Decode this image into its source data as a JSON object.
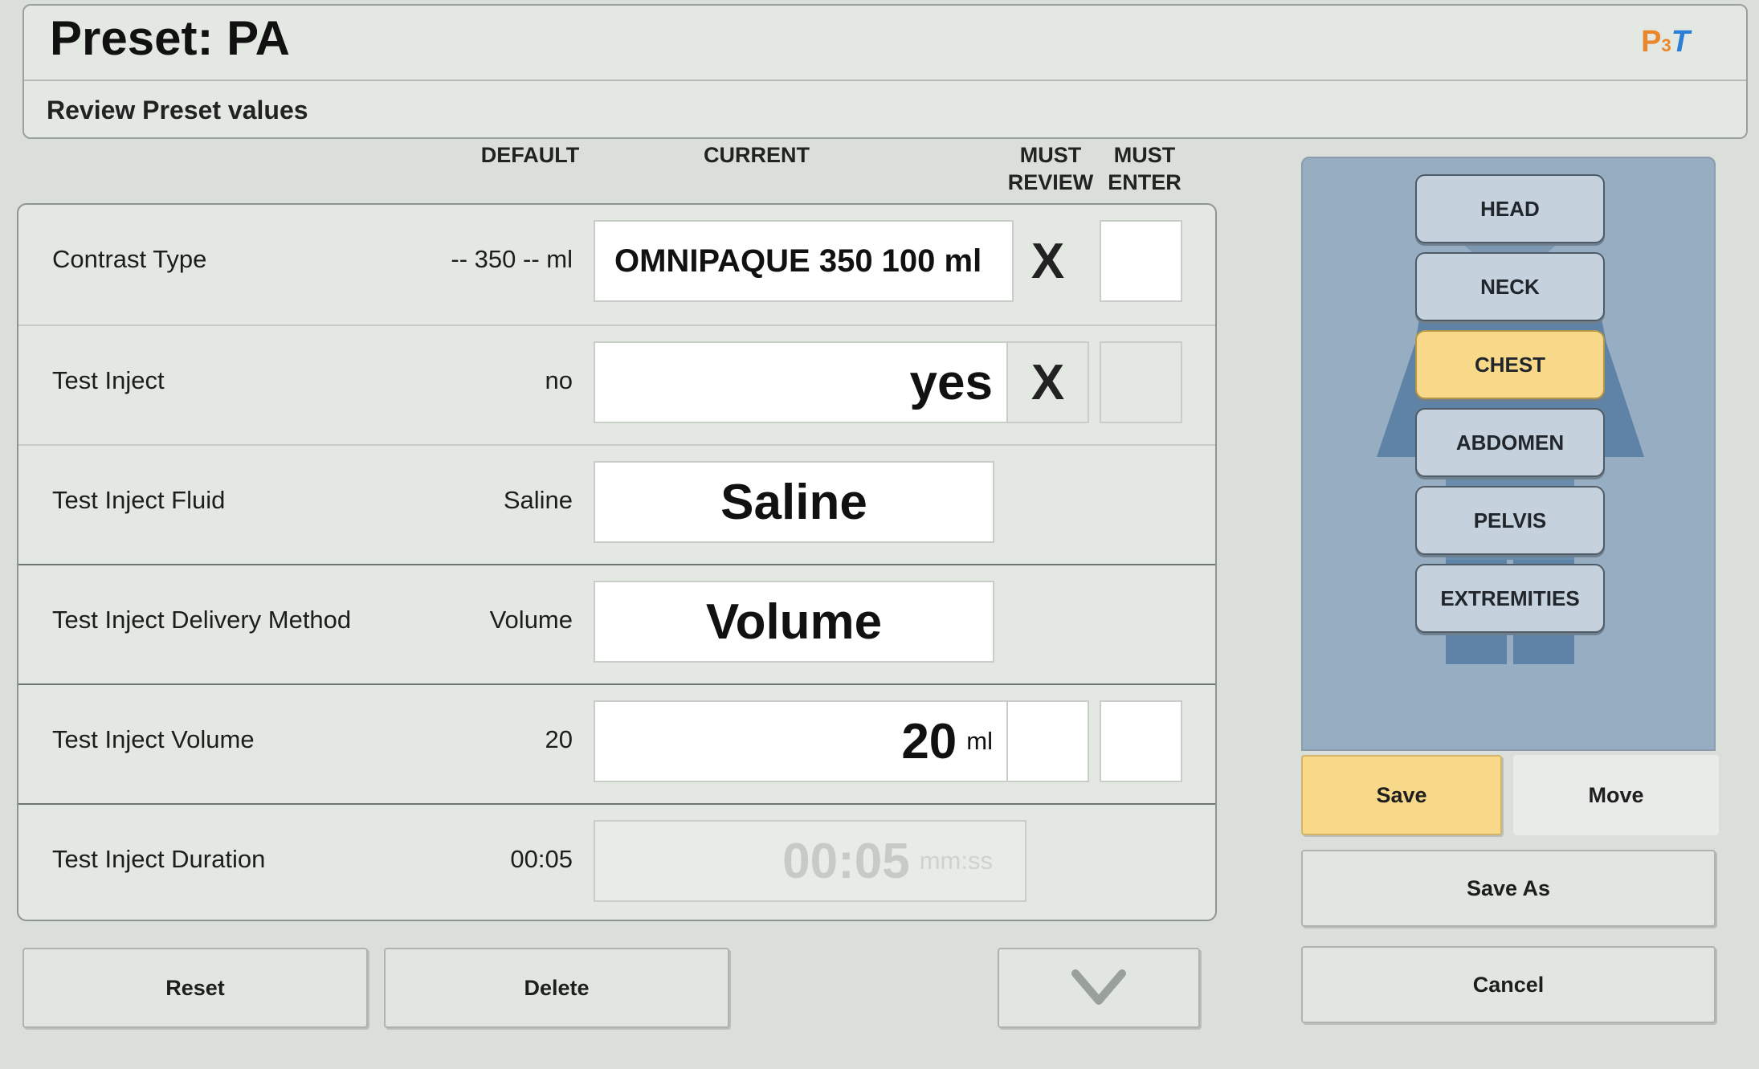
{
  "header": {
    "title": "Preset: PA",
    "subtitle": "Review Preset values",
    "logo": {
      "p": "P",
      "sub": "3",
      "t": "T"
    }
  },
  "columns": {
    "default": "DEFAULT",
    "current": "CURRENT",
    "must_review": "MUST REVIEW",
    "must_enter": "MUST ENTER"
  },
  "rows": [
    {
      "label": "Contrast Type",
      "default": "-- 350 -- ml",
      "value": "OMNIPAQUE 350 100 ml",
      "unit": "",
      "must_review": "X",
      "must_enter": ""
    },
    {
      "label": "Test Inject",
      "default": "no",
      "value": "yes",
      "unit": "",
      "must_review": "X",
      "must_enter": ""
    },
    {
      "label": "Test Inject Fluid",
      "default": "Saline",
      "value": "Saline",
      "unit": ""
    },
    {
      "label": "Test Inject Delivery Method",
      "default": "Volume",
      "value": "Volume",
      "unit": ""
    },
    {
      "label": "Test Inject Volume",
      "default": "20",
      "value": "20",
      "unit": "ml",
      "must_review": "",
      "must_enter": ""
    },
    {
      "label": "Test Inject Duration",
      "default": "00:05",
      "value": "00:05",
      "unit": "mm:ss"
    }
  ],
  "buttons": {
    "reset": "Reset",
    "delete": "Delete",
    "save": "Save",
    "move": "Move",
    "save_as": "Save As",
    "cancel": "Cancel"
  },
  "regions": [
    "HEAD",
    "NECK",
    "CHEST",
    "ABDOMEN",
    "PELVIS",
    "EXTREMITIES"
  ],
  "selected_region": "CHEST",
  "colors": {
    "accent": "#f8d98a",
    "panel": "#97adc2",
    "background": "#dadfda"
  },
  "icons": {
    "scroll_down": "chevron-down-icon"
  }
}
